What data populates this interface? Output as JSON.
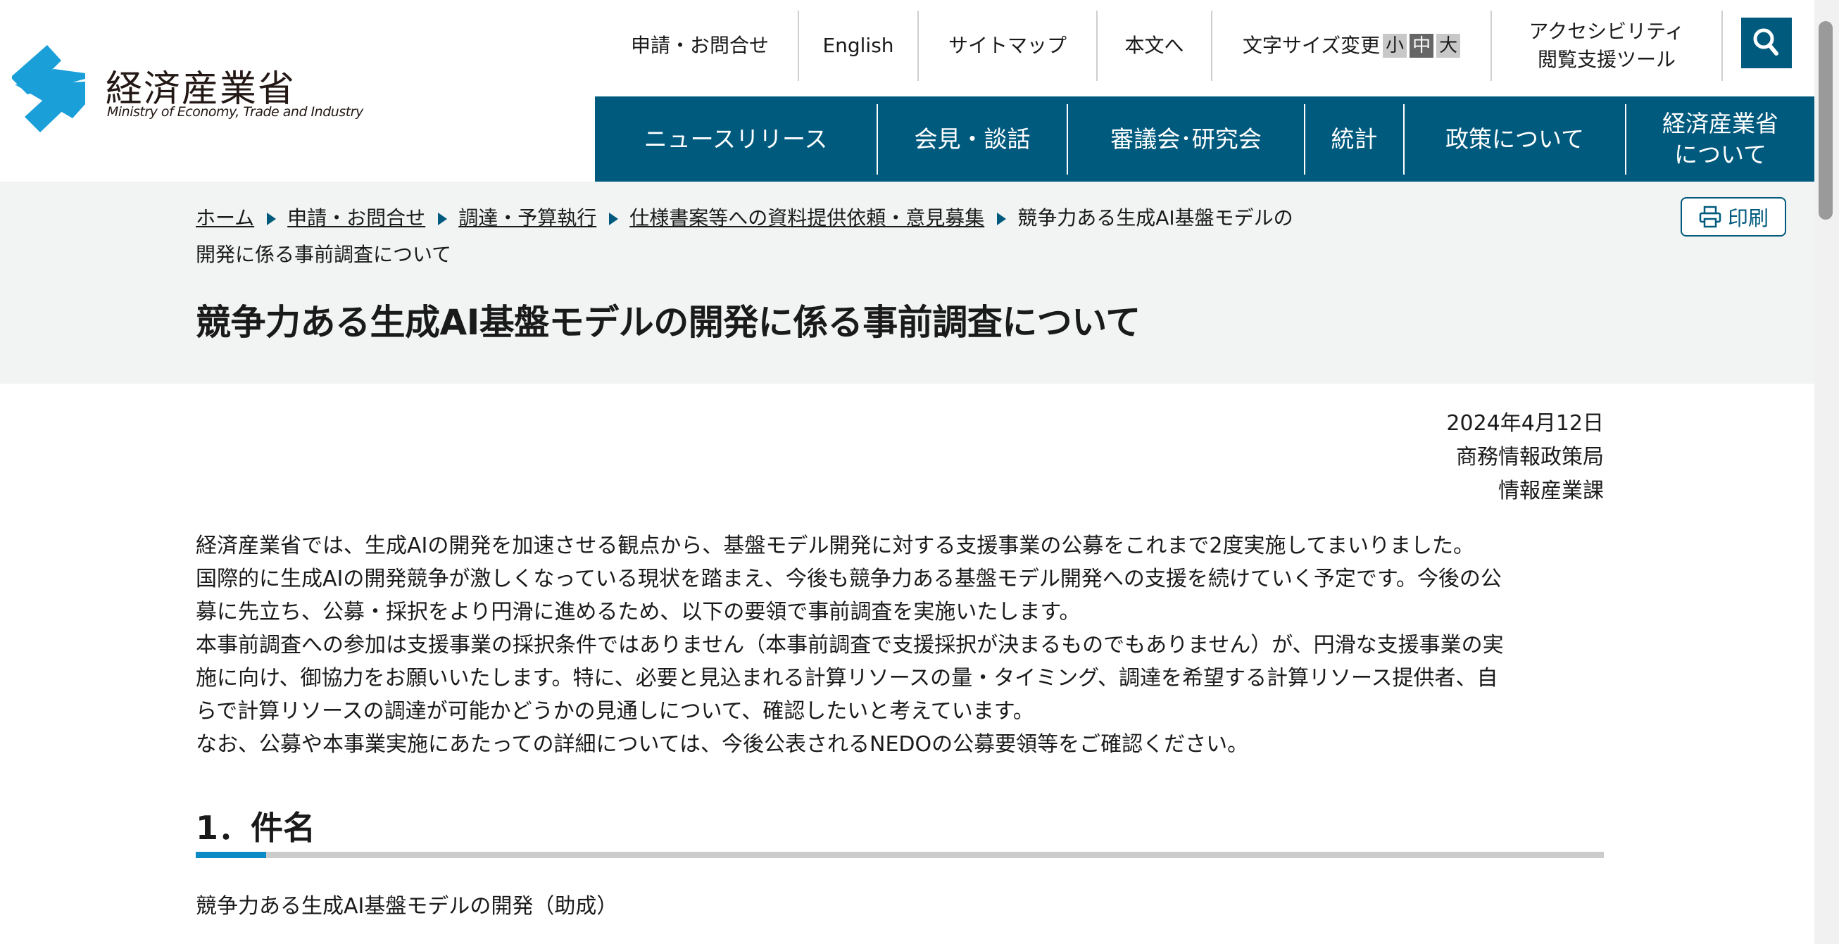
{
  "colors": {
    "brand": "#005a7d",
    "accent": "#0b8bc5",
    "logo": "#1a9fd9",
    "band": "#f1f4f3"
  },
  "logo": {
    "ja": "経済産業省",
    "en": "Ministry of Economy, Trade and Industry"
  },
  "utility": {
    "contact": "申請・お問合せ",
    "english": "English",
    "sitemap": "サイトマップ",
    "skip": "本文へ",
    "font_size_label": "文字サイズ変更",
    "font_sizes": [
      "小",
      "中",
      "大"
    ],
    "font_size_selected": "中",
    "accessibility_line1": "アクセシビリティ",
    "accessibility_line2": "閲覧支援ツール",
    "search_icon": "search-icon"
  },
  "nav": {
    "items": [
      "ニュースリリース",
      "会見・談話",
      "審議会･研究会",
      "統計",
      "政策について"
    ],
    "last_line1": "経済産業省",
    "last_line2": "について"
  },
  "breadcrumb": {
    "links": [
      "ホーム",
      "申請・お問合せ",
      "調達・予算執行",
      "仕様書案等への資料提供依頼・意見募集"
    ],
    "current_line1": "競争力ある生成AI基盤モデルの",
    "current_line2": "開発に係る事前調査について"
  },
  "print_label": "印刷",
  "page_title": "競争力ある生成AI基盤モデルの開発に係る事前調査について",
  "meta": {
    "date": "2024年4月12日",
    "bureau": "商務情報政策局",
    "division": "情報産業課"
  },
  "body_lines": [
    "経済産業省では、生成AIの開発を加速させる観点から、基盤モデル開発に対する支援事業の公募をこれまで2度実施してまいりました。",
    "国際的に生成AIの開発競争が激しくなっている現状を踏まえ、今後も競争力ある基盤モデル開発への支援を続けていく予定です。今後の公",
    "募に先立ち、公募・採択をより円滑に進めるため、以下の要領で事前調査を実施いたします。",
    "本事前調査への参加は支援事業の採択条件ではありません（本事前調査で支援採択が決まるものでもありません）が、円滑な支援事業の実",
    "施に向け、御協力をお願いいたします。特に、必要と見込まれる計算リソースの量・タイミング、調達を希望する計算リソース提供者、自",
    "らで計算リソースの調達が可能かどうかの見通しについて、確認したいと考えています。",
    "なお、公募や本事業実施にあたっての詳細については、今後公表されるNEDOの公募要領等をご確認ください。"
  ],
  "section1": {
    "heading": "1．件名",
    "text": "競争力ある生成AI基盤モデルの開発（助成）"
  }
}
